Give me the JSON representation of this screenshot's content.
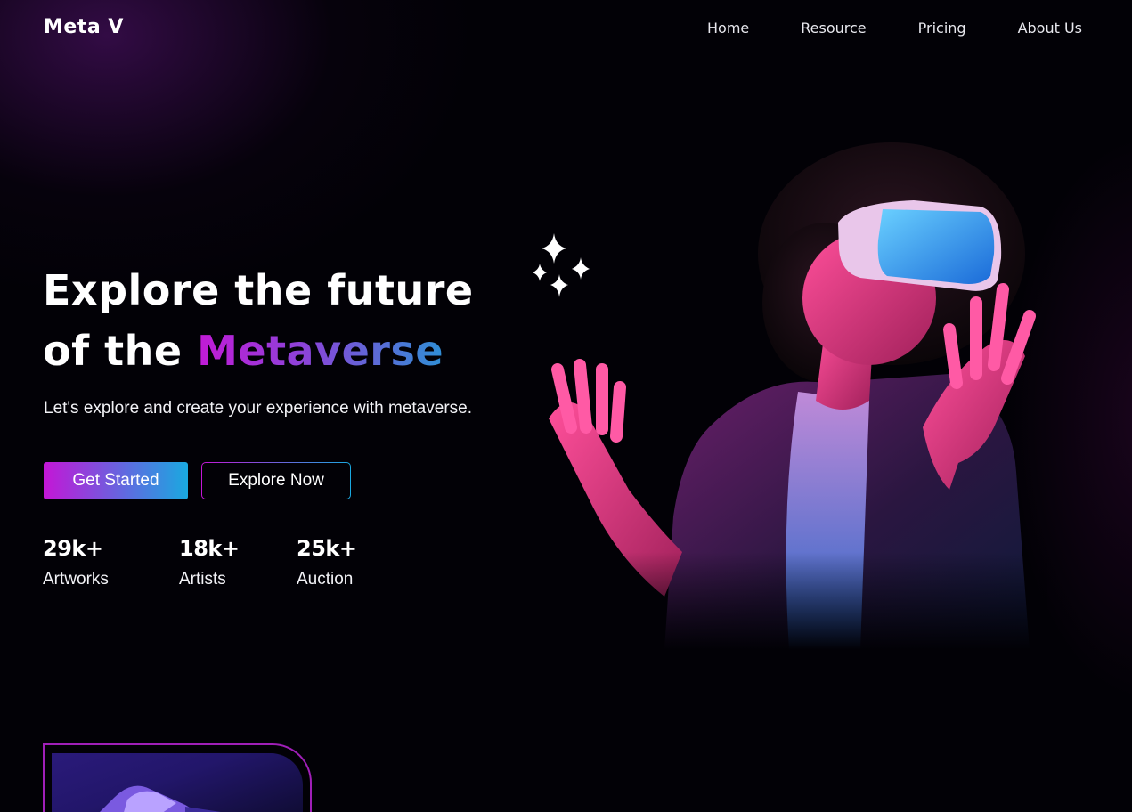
{
  "header": {
    "logo": "Meta V",
    "nav": [
      "Home",
      "Resource",
      "Pricing",
      "About Us"
    ]
  },
  "hero": {
    "title_line1": "Explore the future",
    "title_line2_prefix": "of the ",
    "title_line2_accent": "Metaverse",
    "subtitle": "Let's explore and create your experience with metaverse.",
    "primary_button": "Get Started",
    "secondary_button": "Explore Now"
  },
  "stats": [
    {
      "value": "29k+",
      "label": "Artworks"
    },
    {
      "value": "18k+",
      "label": "Artists"
    },
    {
      "value": "25k+",
      "label": "Auction"
    }
  ],
  "colors": {
    "background": "#020106",
    "accent_magenta": "#c416d6",
    "accent_blue": "#1aa9e0",
    "card_border": "#a01fb8"
  },
  "icons": {
    "sparkles": "sparkles-icon",
    "hero": "vr-headset-person-image",
    "card": "vr-headset-image"
  }
}
